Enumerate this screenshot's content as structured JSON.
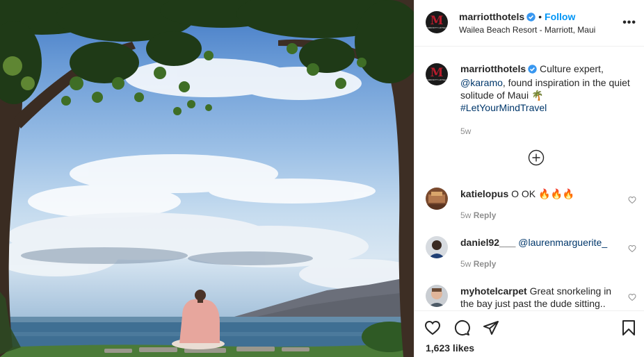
{
  "header": {
    "username": "marriotthotels",
    "dot": "•",
    "follow_label": "Follow",
    "location": "Wailea Beach Resort - Marriott, Maui",
    "logo_letter": "M",
    "logo_sub": "MARRIOTT HOTELS",
    "more_label": "•••"
  },
  "caption": {
    "username": "marriotthotels",
    "text_before": "Culture expert,",
    "mention": "@karamo",
    "text_after": ", found inspiration in the quiet solitude of Maui 🌴",
    "hashtag": "#LetYourMindTravel",
    "age": "5w"
  },
  "comments": [
    {
      "username": "katielopus",
      "text": "O OK 🔥🔥🔥",
      "age": "5w",
      "reply_label": "Reply"
    },
    {
      "username": "daniel92___",
      "text": "@laurenmarguerite_",
      "age": "5w",
      "reply_label": "Reply"
    },
    {
      "username": "myhotelcarpet",
      "text": "Great snorkeling in the bay just past the dude sitting..",
      "age": "",
      "reply_label": ""
    }
  ],
  "footer": {
    "likes": "1,623 likes"
  },
  "icons": {
    "like": "heart-icon",
    "comment": "comment-bubble-icon",
    "share": "paper-plane-icon",
    "save": "bookmark-icon",
    "more_comments": "plus-circle-icon",
    "verified": "verified-badge-icon",
    "options": "more-options-icon"
  },
  "colors": {
    "link": "#00376b",
    "follow": "#0095f6",
    "verified": "#3897f0",
    "muted": "#8e8e8e",
    "brand": "#b71c2c"
  }
}
